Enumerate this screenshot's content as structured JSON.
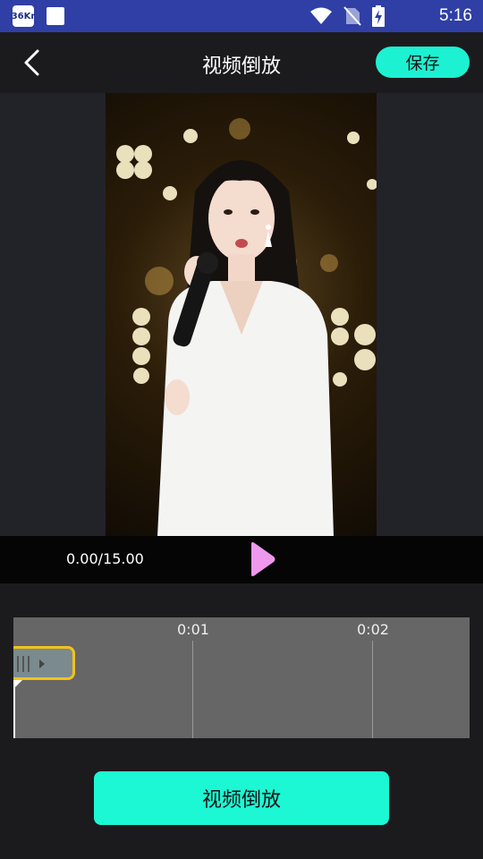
{
  "status_bar": {
    "app_badge": "36Kr",
    "time": "5:16"
  },
  "header": {
    "title": "视频倒放",
    "save_label": "保存",
    "back_icon": "chevron-left-icon"
  },
  "player": {
    "time_display": "0.00/15.00",
    "play_icon": "play-icon",
    "play_color": "#ee99ee"
  },
  "timeline": {
    "ticks": [
      "0:01",
      "0:02"
    ],
    "playhead_fraction": 0
  },
  "actions": {
    "reverse_label": "视频倒放"
  },
  "colors": {
    "accent": "#1cf2d2",
    "status_bar": "#2f3fa6",
    "clip_border": "#f2c21c"
  }
}
